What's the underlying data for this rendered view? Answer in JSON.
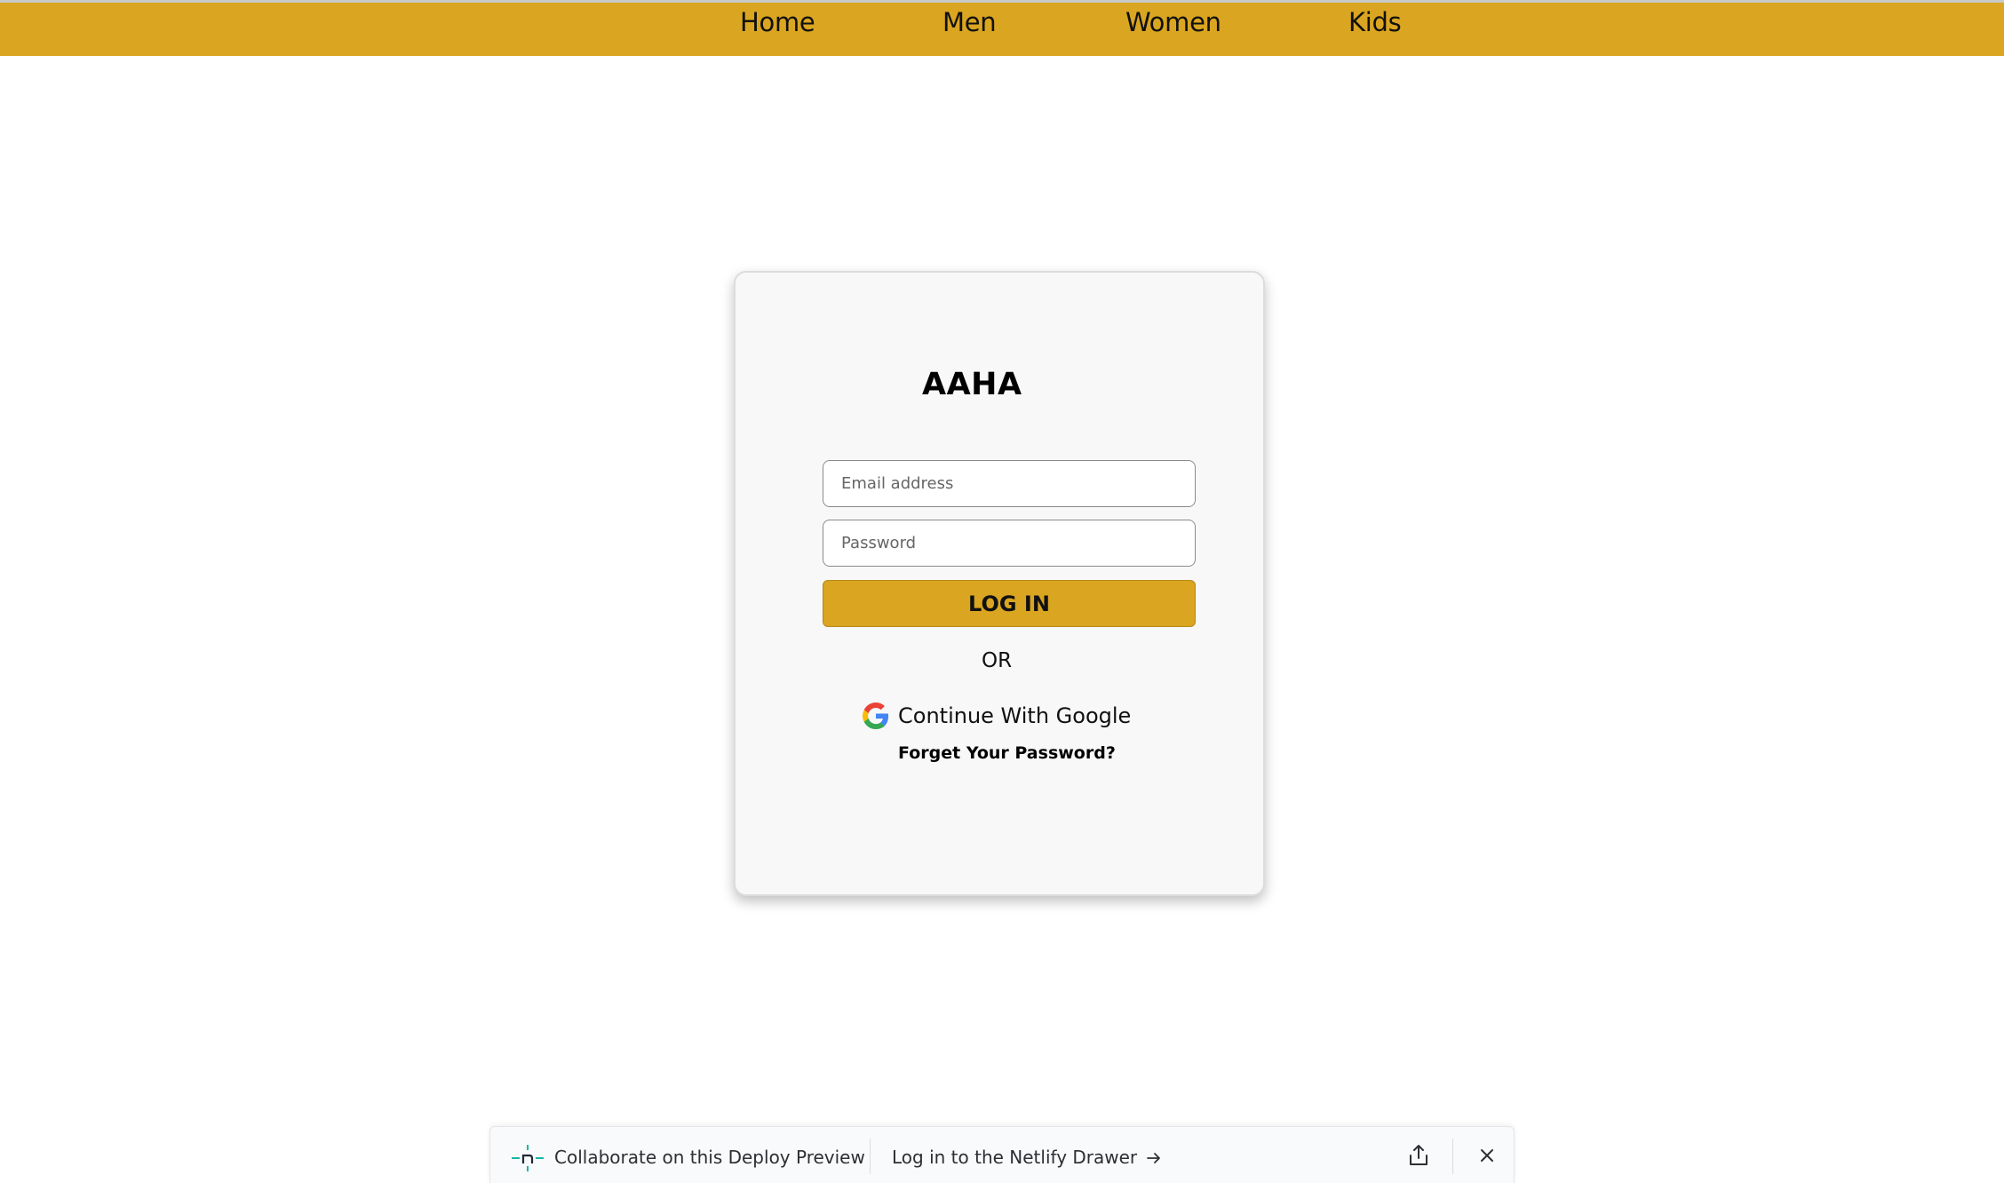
{
  "nav": {
    "items": [
      {
        "label": "Home"
      },
      {
        "label": "Men"
      },
      {
        "label": "Women"
      },
      {
        "label": "Kids"
      }
    ]
  },
  "login": {
    "brand": "AAHA",
    "email_placeholder": "Email address",
    "password_placeholder": "Password",
    "login_label": "LOG IN",
    "or_text": "OR",
    "google_label": "Continue With Google",
    "forgot_label": "Forget Your Password?"
  },
  "deploy_bar": {
    "collab_text": "Collaborate on this Deploy Preview",
    "drawer_text": "Log in to the Netlify Drawer"
  },
  "colors": {
    "accent": "#daa520",
    "netlify_teal": "#14b8a6"
  },
  "icons": [
    "google-icon",
    "netlify-icon",
    "arrow-right-icon",
    "share-icon",
    "close-icon"
  ]
}
